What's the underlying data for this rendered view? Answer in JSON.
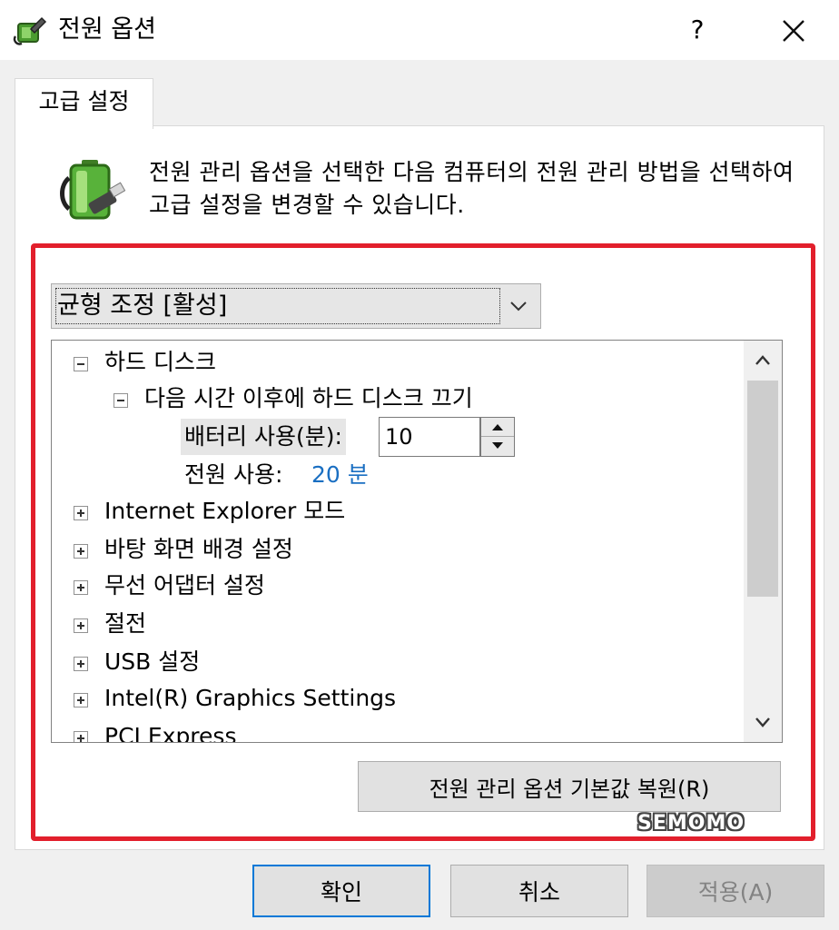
{
  "window": {
    "title": "전원 옵션",
    "help_label": "?"
  },
  "tab": {
    "label": "고급 설정"
  },
  "description": "전원 관리 옵션을 선택한 다음 컴퓨터의 전원 관리 방법을 선택하여 고급 설정을 변경할 수 있습니다.",
  "plan_select": {
    "value": "균형 조정 [활성]"
  },
  "tree": {
    "hard_disk": "하드 디스크",
    "turn_off_after": "다음 시간 이후에 하드 디스크 끄기",
    "battery_label": "배터리 사용(분):",
    "battery_value": "10",
    "ac_label": "전원 사용:",
    "ac_value": "20 분",
    "items": [
      "Internet Explorer 모드",
      "바탕 화면 배경 설정",
      "무선 어댑터 설정",
      "절전",
      "USB 설정",
      "Intel(R) Graphics Settings",
      "PCI Express"
    ]
  },
  "restore_button": "전원 관리 옵션 기본값 복원(R)",
  "watermark": "SEMOMO",
  "buttons": {
    "ok": "확인",
    "cancel": "취소",
    "apply": "적용(A)"
  },
  "colors": {
    "highlight_border": "#e21f2c",
    "link_value": "#1a6fc2",
    "focus_border": "#0078d7"
  },
  "icons": {
    "app": "power-options-icon",
    "header": "battery-plug-icon"
  }
}
